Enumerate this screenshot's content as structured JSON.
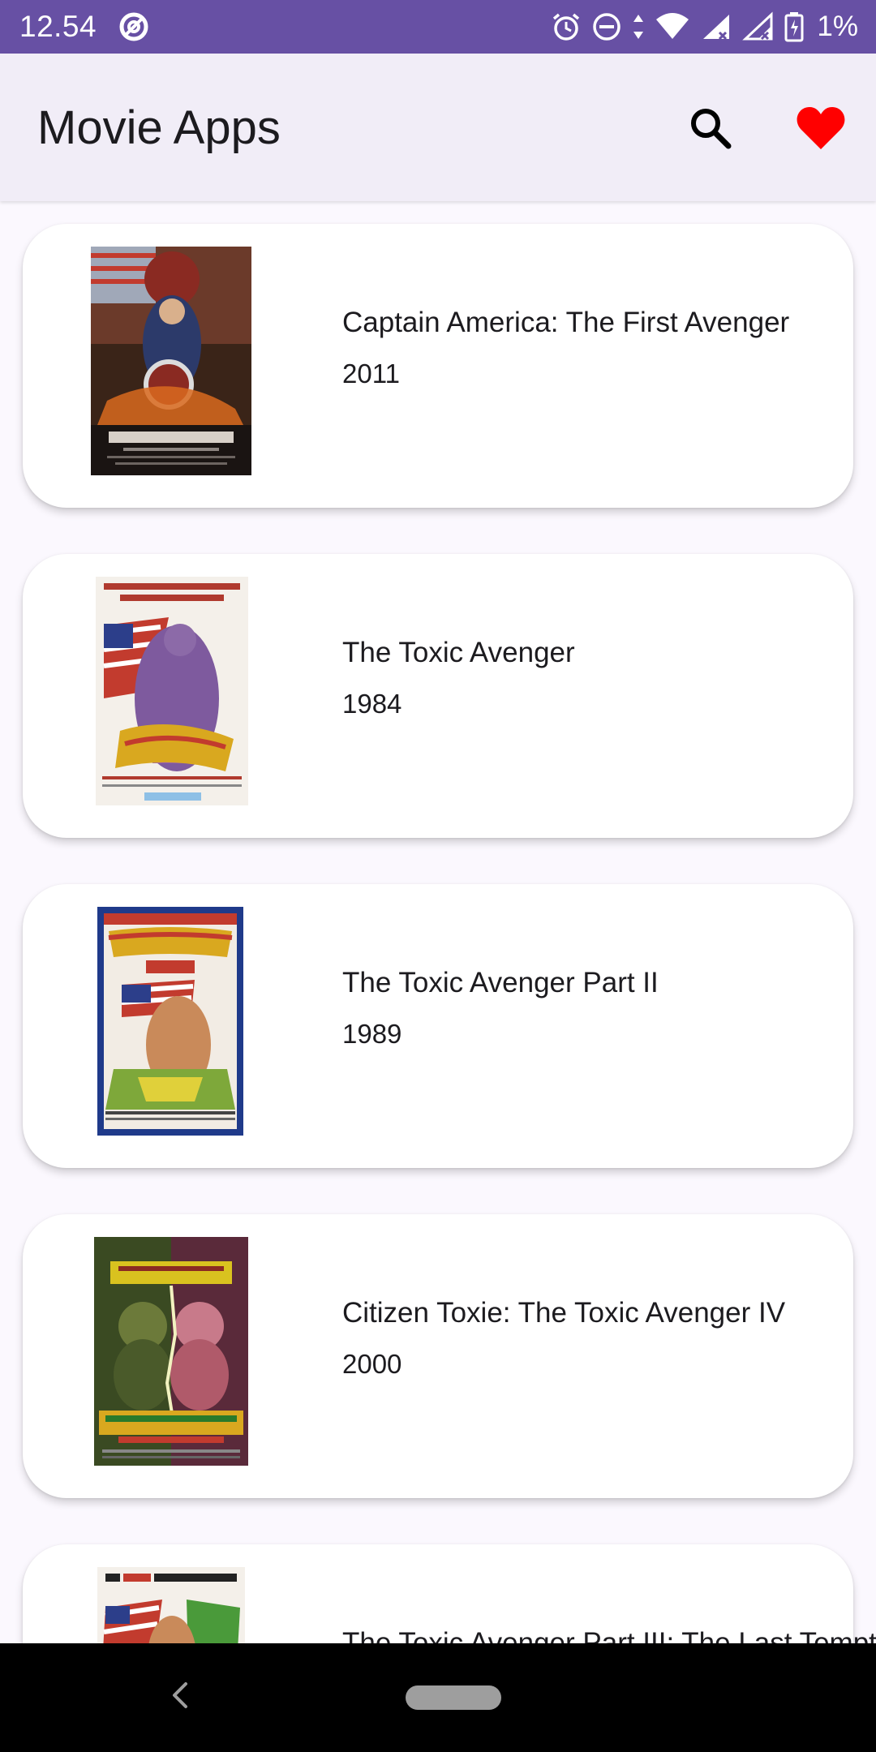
{
  "status_bar": {
    "time": "12.54",
    "battery_text": "1%"
  },
  "app_bar": {
    "title": "Movie Apps",
    "search_icon": "search-icon",
    "favorite_icon": "heart-icon",
    "favorite_color": "#ff0000"
  },
  "movies": [
    {
      "title": "Captain America: The First Avenger",
      "year": "2011"
    },
    {
      "title": "The Toxic Avenger",
      "year": "1984"
    },
    {
      "title": "The Toxic Avenger Part II",
      "year": "1989"
    },
    {
      "title": "Citizen Toxie: The Toxic Avenger IV",
      "year": "2000"
    },
    {
      "title": "The Toxic Avenger Part III: The Last Temptation of Toxie",
      "year": ""
    }
  ],
  "colors": {
    "status_bar": "#6750a4",
    "app_bar": "#f1edf7",
    "background": "#fbf8fe",
    "card": "#ffffff"
  }
}
